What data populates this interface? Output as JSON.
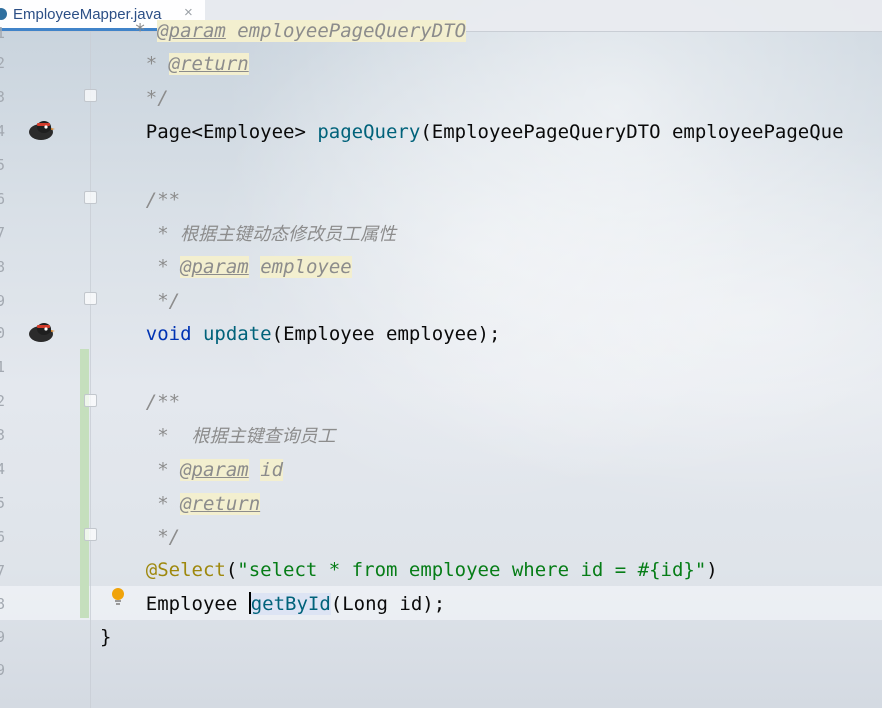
{
  "tab": {
    "filename": "EmployeeMapper.java",
    "close": "×"
  },
  "gutter": {
    "line_numbers": [
      "1",
      "2",
      "3",
      "4",
      "5",
      "6",
      "7",
      "8",
      "9",
      "0",
      "1",
      "2",
      "3",
      "4",
      "5",
      "6",
      "7",
      "8",
      "9",
      "9"
    ]
  },
  "code": {
    "l1_at": "@param",
    "l1_rest": " employeePageQueryDTO",
    "l2_star": " * ",
    "l2_tag": "@return",
    "l3": " */",
    "l4_type": "Page<Employee> ",
    "l4_fn": "pageQuery",
    "l4_args": "(EmployeePageQueryDTO employeePageQue",
    "l6": "/**",
    "l7_star": " * ",
    "l7_text": "根据主键动态修改员工属性",
    "l8_star": " * ",
    "l8_tag": "@param",
    "l8_val": "employee",
    "l9": " */",
    "l10_kw": "void",
    "l10_fn": "update",
    "l10_args": "(Employee employee);",
    "l12": "/**",
    "l13_star": " *  ",
    "l13_text": "根据主键查询员工",
    "l14_star": " * ",
    "l14_tag": "@param",
    "l14_val": "id",
    "l15_star": " * ",
    "l15_tag": "@return",
    "l16": " */",
    "l17_ann": "@Select",
    "l17_open": "(",
    "l17_str": "\"select * from employee where id = #{id}\"",
    "l17_close": ")",
    "l18_type": "Employee ",
    "l18_fn": "getById",
    "l18_args": "(Long id);",
    "l19": "}"
  },
  "colors": {
    "accent": "#4083c9",
    "change_bar": "#c5dfbd",
    "keyword": "#0033b3",
    "string": "#067d17",
    "annotation": "#9e880d"
  }
}
